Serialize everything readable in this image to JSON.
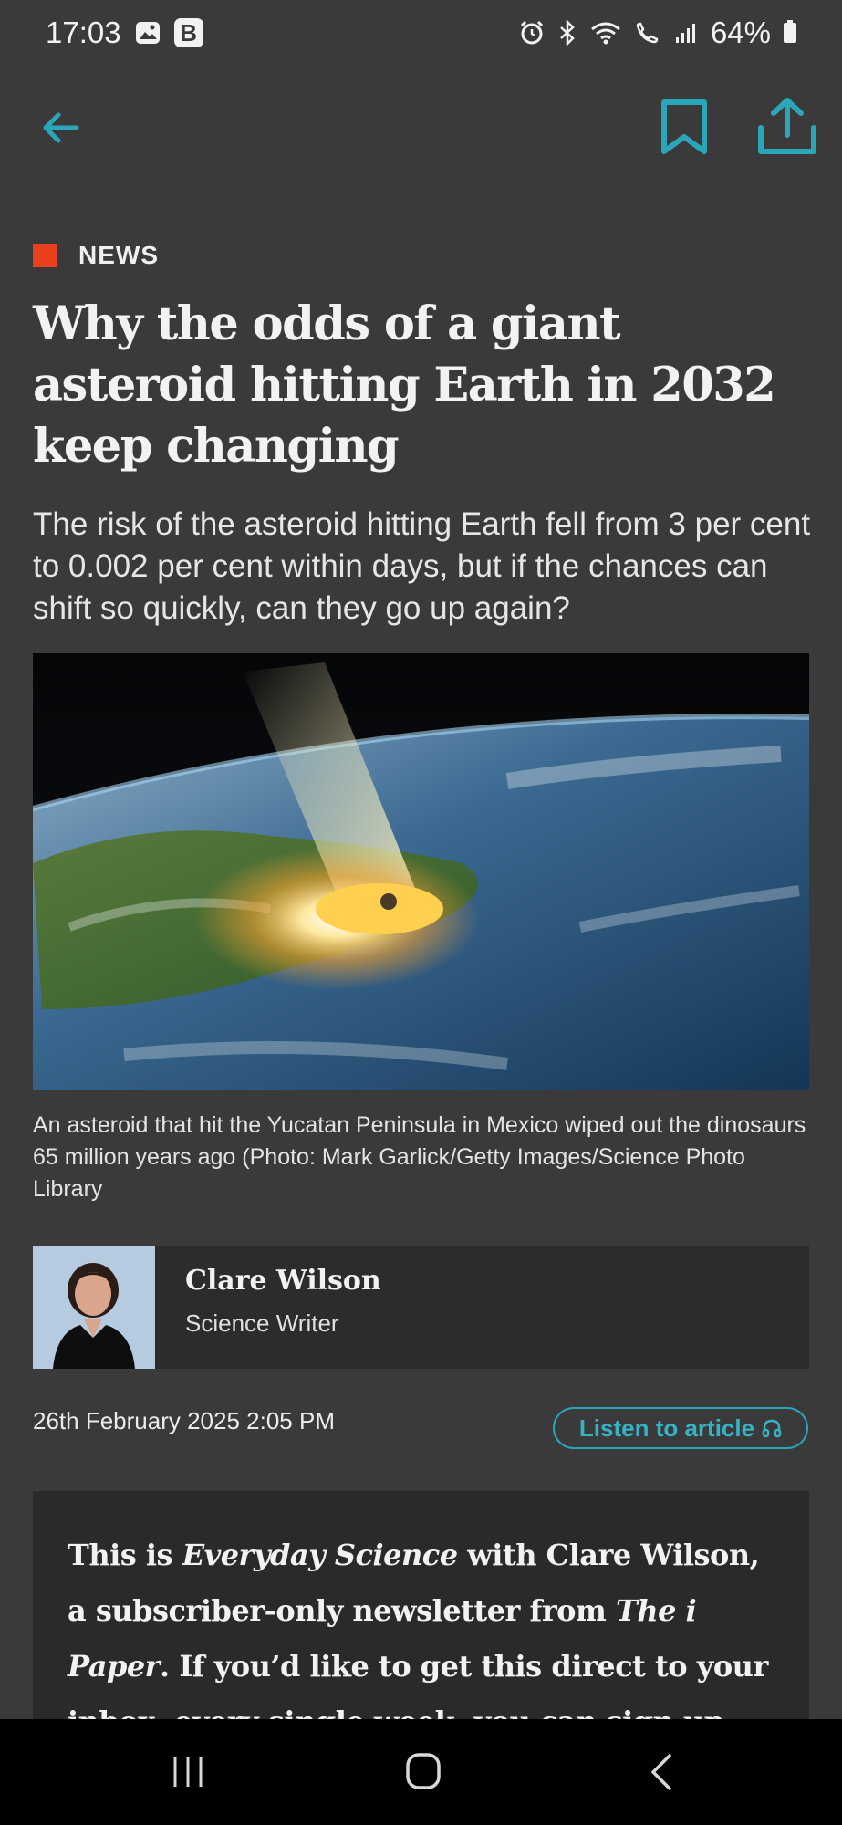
{
  "status_bar": {
    "time": "17:03",
    "battery": "64%",
    "icons": [
      "gallery-icon",
      "b-icon",
      "alarm-icon",
      "bluetooth-icon",
      "wifi-icon",
      "wifi-calling-icon",
      "signal-icon",
      "battery-icon"
    ]
  },
  "toolbar": {
    "accent_color": "#2aa6b8",
    "icons": [
      "back-arrow-icon",
      "bookmark-icon",
      "share-icon"
    ]
  },
  "article": {
    "category": "NEWS",
    "category_color": "#e8401c",
    "headline": "Why the odds of a giant asteroid hitting Earth in 2032 keep changing",
    "standfirst": "The risk of the asteroid hitting Earth fell from 3 per cent to 0.002 per cent within days, but if the chances can shift so quickly, can they go up again?",
    "caption": "An asteroid that hit the Yucatan Peninsula in Mexico wiped out the dinosaurs 65 million years ago (Photo: Mark Garlick/Getty Images/Science Photo Library",
    "author": {
      "name": "Clare Wilson",
      "role": "Science Writer"
    },
    "date": "26th February 2025 2:05 PM",
    "listen_label": "Listen to article",
    "newsletter": {
      "part1": "This is ",
      "italic1": "Everyday Science",
      "part2": " with Clare Wilson, a subscriber-only newsletter from ",
      "italic2": "The i Paper",
      "part3": ". If you’d like to get this direct to your inbox, every single week, you can sign up"
    }
  },
  "nav_bar": {
    "icons": [
      "recents-icon",
      "home-icon",
      "back-icon"
    ]
  }
}
